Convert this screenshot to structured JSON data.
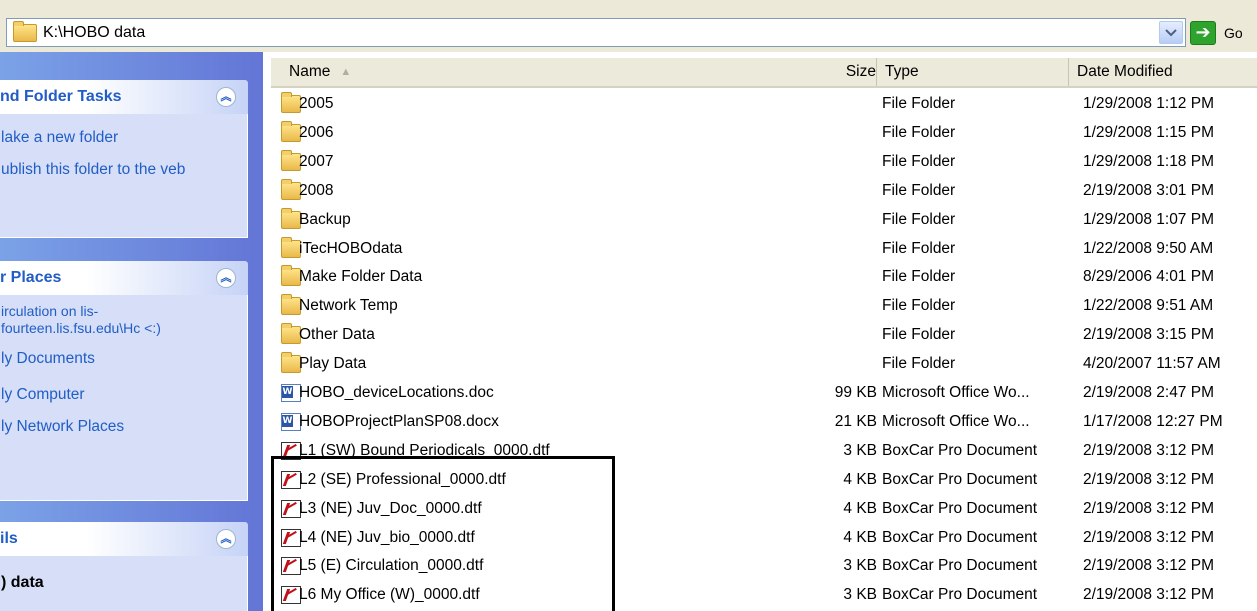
{
  "address": {
    "path": "K:\\HOBO data",
    "go_label": "Go"
  },
  "taskpane": {
    "file_tasks": {
      "title": "nd Folder Tasks",
      "links": [
        "lake a new folder",
        "ublish this folder to the veb"
      ]
    },
    "other_places": {
      "title": "r Places",
      "links": [
        "irculation on lis-fourteen.lis.fsu.edu\\Hc <:)",
        "ly Documents",
        "ly Computer",
        "ly Network Places"
      ]
    },
    "details": {
      "title": "ils",
      "name": ") data"
    }
  },
  "columns": {
    "name": "Name",
    "size": "Size",
    "type": "Type",
    "date": "Date Modified"
  },
  "files": [
    {
      "icon": "folder-icon",
      "name": "2005",
      "size": "",
      "type": "File Folder",
      "date": "1/29/2008 1:12 PM"
    },
    {
      "icon": "folder-icon",
      "name": "2006",
      "size": "",
      "type": "File Folder",
      "date": "1/29/2008 1:15 PM"
    },
    {
      "icon": "folder-icon",
      "name": "2007",
      "size": "",
      "type": "File Folder",
      "date": "1/29/2008 1:18 PM"
    },
    {
      "icon": "folder-icon",
      "name": "2008",
      "size": "",
      "type": "File Folder",
      "date": "2/19/2008 3:01 PM"
    },
    {
      "icon": "folder-icon",
      "name": "Backup",
      "size": "",
      "type": "File Folder",
      "date": "1/29/2008 1:07 PM"
    },
    {
      "icon": "folder-icon",
      "name": "iTecHOBOdata",
      "size": "",
      "type": "File Folder",
      "date": "1/22/2008 9:50 AM"
    },
    {
      "icon": "folder-icon",
      "name": "Make Folder Data",
      "size": "",
      "type": "File Folder",
      "date": "8/29/2006 4:01 PM"
    },
    {
      "icon": "folder-icon",
      "name": "Network Temp",
      "size": "",
      "type": "File Folder",
      "date": "1/22/2008 9:51 AM"
    },
    {
      "icon": "folder-icon",
      "name": "Other Data",
      "size": "",
      "type": "File Folder",
      "date": "2/19/2008 3:15 PM"
    },
    {
      "icon": "folder-icon",
      "name": "Play Data",
      "size": "",
      "type": "File Folder",
      "date": "4/20/2007 11:57 AM"
    },
    {
      "icon": "word-doc-icon",
      "name": "HOBO_deviceLocations.doc",
      "size": "99 KB",
      "type": "Microsoft Office Wo...",
      "date": "2/19/2008 2:47 PM"
    },
    {
      "icon": "word-doc-icon",
      "name": "HOBOProjectPlanSP08.docx",
      "size": "21 KB",
      "type": "Microsoft Office Wo...",
      "date": "1/17/2008 12:27 PM"
    },
    {
      "icon": "boxcar-dtf-icon",
      "name": "L1 (SW)  Bound Periodicals_0000.dtf",
      "size": "3 KB",
      "type": "BoxCar Pro Document",
      "date": "2/19/2008 3:12 PM"
    },
    {
      "icon": "boxcar-dtf-icon",
      "name": "L2 (SE) Professional_0000.dtf",
      "size": "4 KB",
      "type": "BoxCar Pro Document",
      "date": "2/19/2008 3:12 PM"
    },
    {
      "icon": "boxcar-dtf-icon",
      "name": "L3 (NE) Juv_Doc_0000.dtf",
      "size": "4 KB",
      "type": "BoxCar Pro Document",
      "date": "2/19/2008 3:12 PM"
    },
    {
      "icon": "boxcar-dtf-icon",
      "name": "L4 (NE) Juv_bio_0000.dtf",
      "size": "4 KB",
      "type": "BoxCar Pro Document",
      "date": "2/19/2008 3:12 PM"
    },
    {
      "icon": "boxcar-dtf-icon",
      "name": "L5 (E) Circulation_0000.dtf",
      "size": "3 KB",
      "type": "BoxCar Pro Document",
      "date": "2/19/2008 3:12 PM"
    },
    {
      "icon": "boxcar-dtf-icon",
      "name": "L6 My Office (W)_0000.dtf",
      "size": "3 KB",
      "type": "BoxCar Pro Document",
      "date": "2/19/2008 3:12 PM"
    }
  ]
}
